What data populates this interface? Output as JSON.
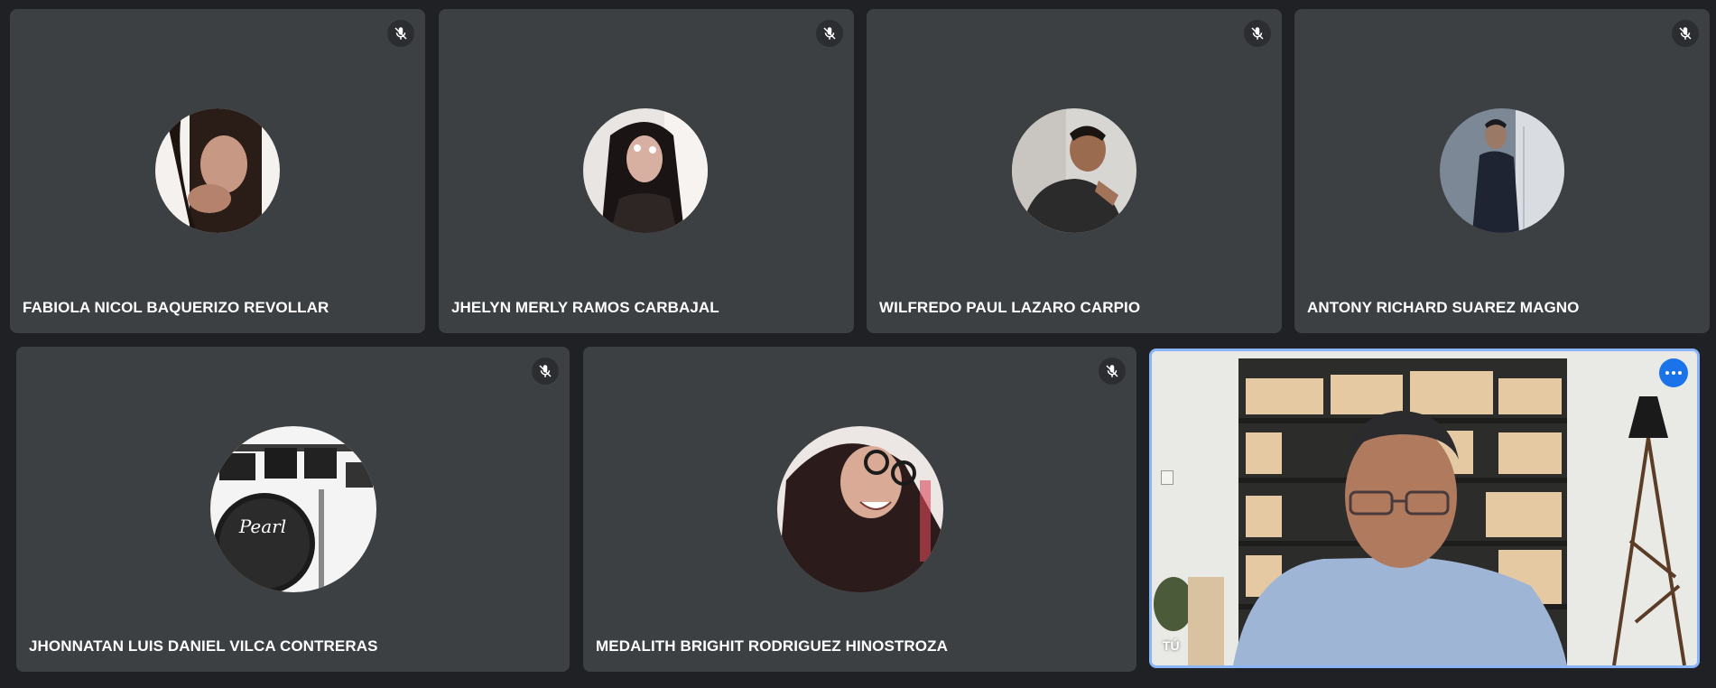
{
  "participants": [
    {
      "name": "FABIOLA NICOL BAQUERIZO REVOLLAR",
      "muted": true,
      "avatar_icon": "profile-photo-icon"
    },
    {
      "name": "JHELYN MERLY RAMOS CARBAJAL",
      "muted": true,
      "avatar_icon": "profile-photo-icon"
    },
    {
      "name": "WILFREDO PAUL LAZARO CARPIO",
      "muted": true,
      "avatar_icon": "profile-photo-icon"
    },
    {
      "name": "ANTONY RICHARD SUAREZ MAGNO",
      "muted": true,
      "avatar_icon": "profile-photo-icon"
    },
    {
      "name": "JHONNATAN LUIS DANIEL VILCA CONTRERAS",
      "muted": true,
      "avatar_icon": "drum-kit-photo-icon"
    },
    {
      "name": "MEDALITH BRIGHIT RODRIGUEZ HINOSTROZA",
      "muted": true,
      "avatar_icon": "profile-photo-icon"
    }
  ],
  "self_view": {
    "label": "TÚ",
    "more_options_icon": "more-horizontal-icon"
  },
  "icons": {
    "mute": "mic-off-icon"
  },
  "colors": {
    "background": "#202124",
    "tile": "#3c4043",
    "self_border": "#8ab4f8",
    "accent": "#1a73e8"
  }
}
